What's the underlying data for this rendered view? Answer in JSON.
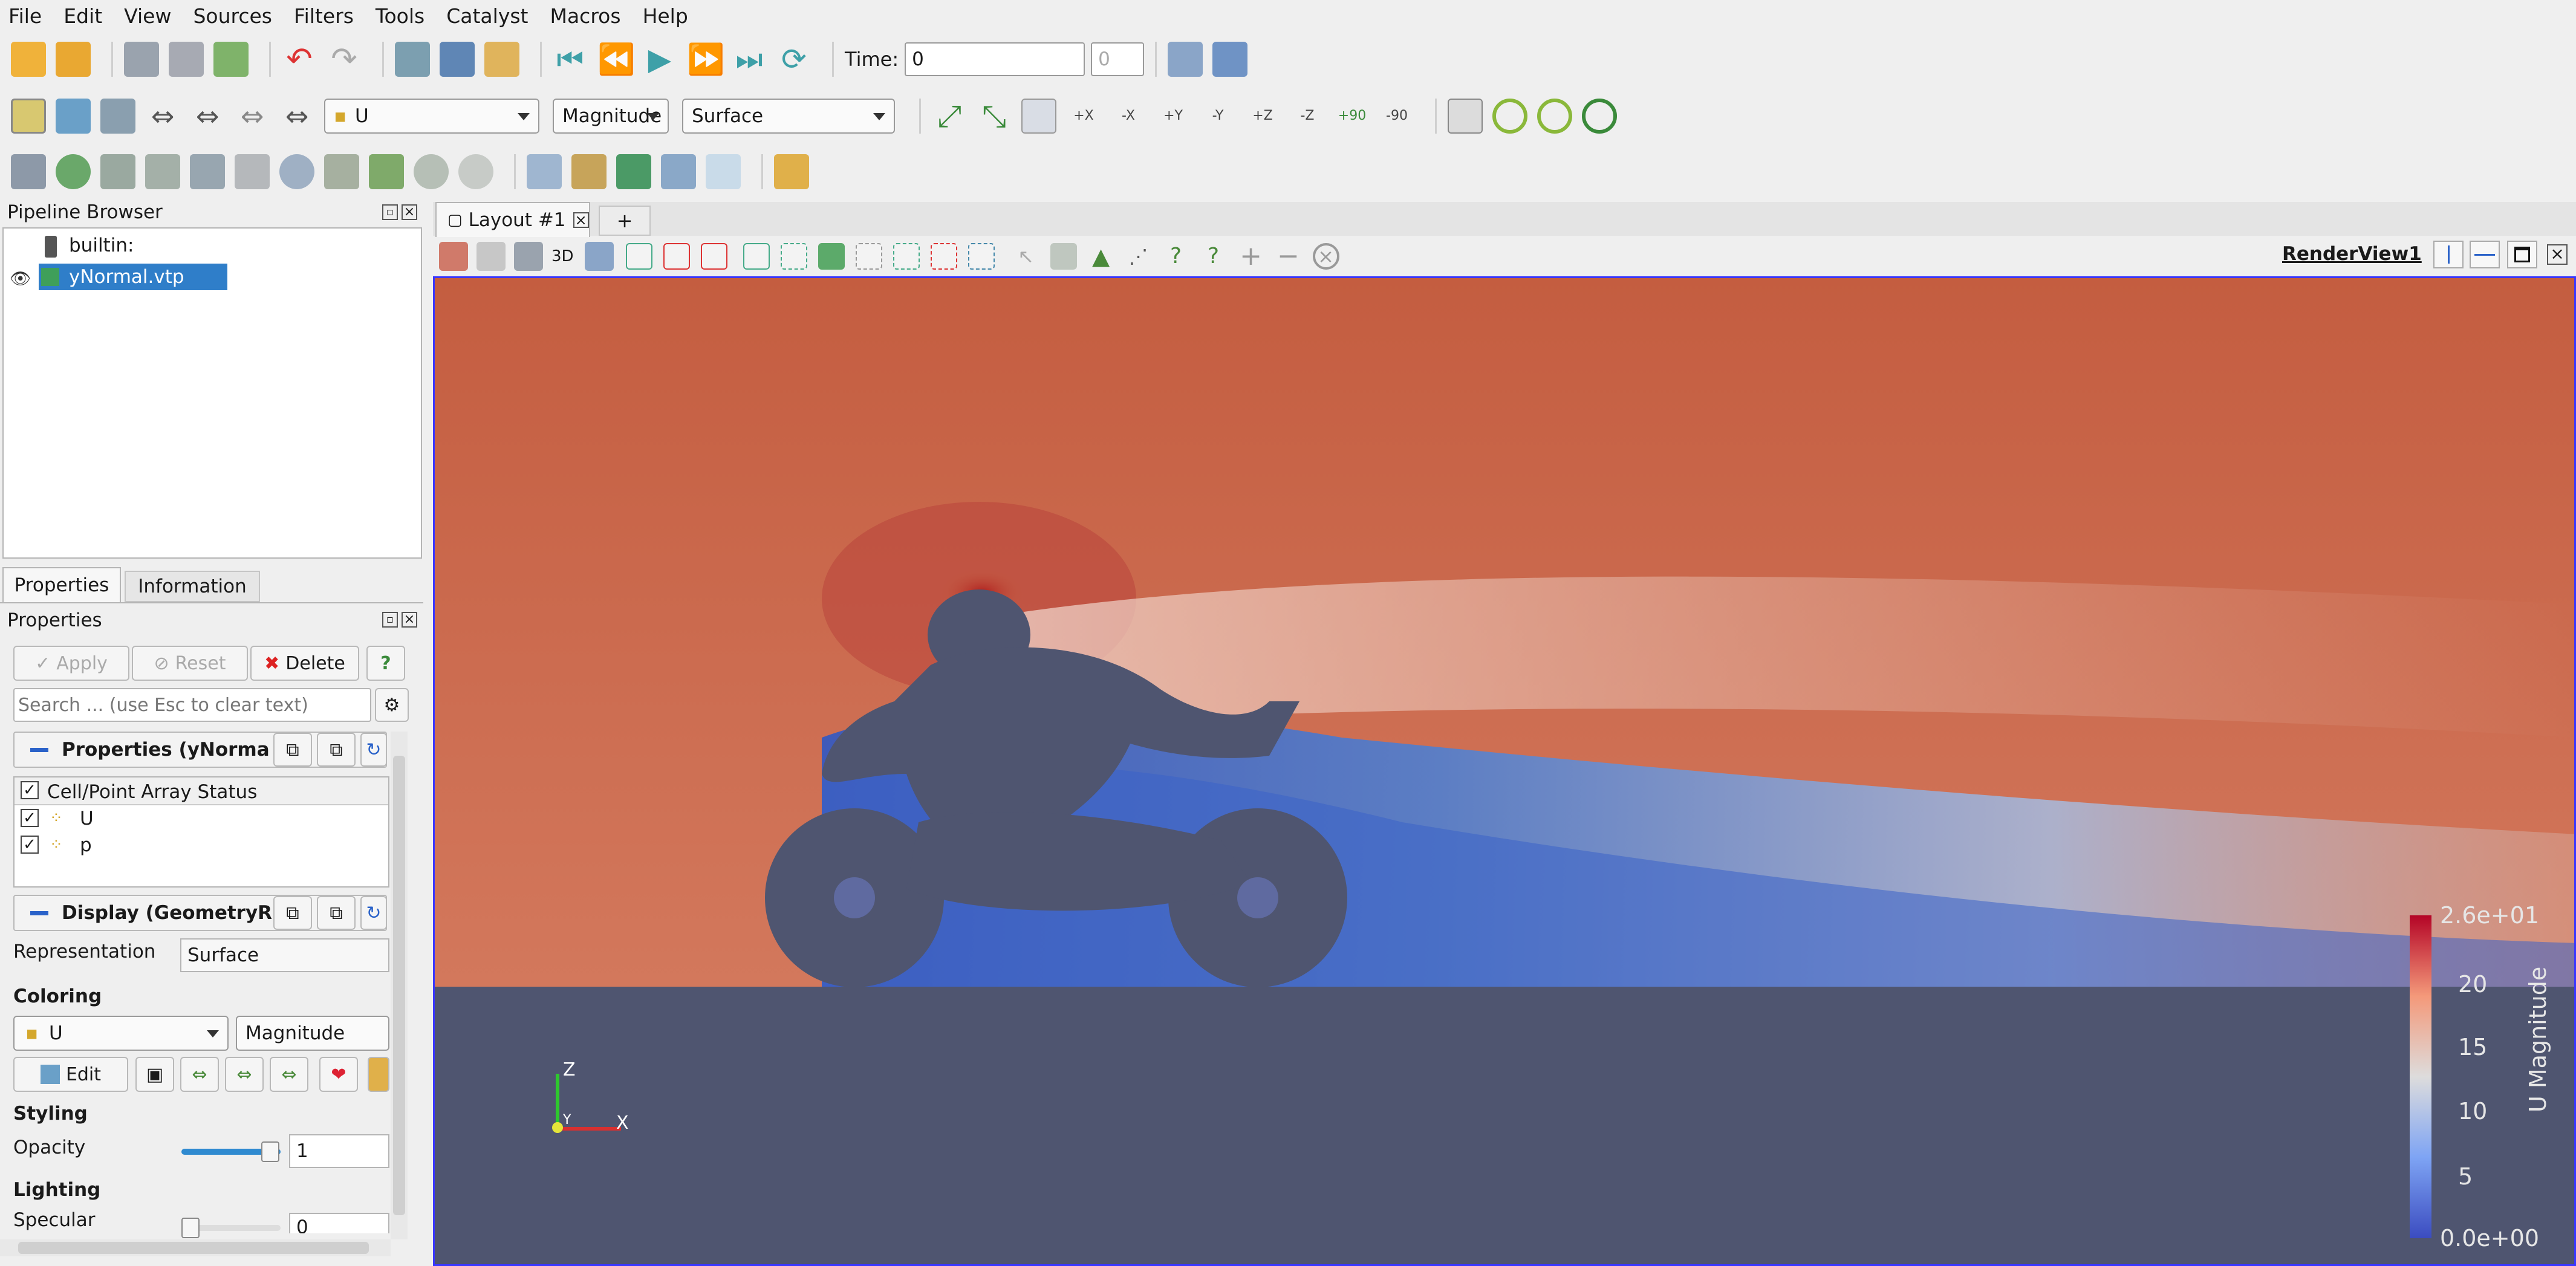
{
  "menu": [
    "File",
    "Edit",
    "View",
    "Sources",
    "Filters",
    "Tools",
    "Catalyst",
    "Macros",
    "Help"
  ],
  "toolbar": {
    "time_label": "Time:",
    "time_value": "0",
    "timestep_value": "0",
    "array_combo": "U",
    "component_combo": "Magnitude",
    "representation_combo": "Surface",
    "axis_labels": [
      "+X",
      "-X",
      "+Y",
      "-Y",
      "+Z",
      "-Z"
    ],
    "rotate_labels": [
      "+90",
      "-90"
    ]
  },
  "pipeline": {
    "title": "Pipeline Browser",
    "root": "builtin:",
    "item": "yNormal.vtp"
  },
  "tabs": {
    "properties": "Properties",
    "information": "Information"
  },
  "properties": {
    "title": "Properties",
    "apply": "Apply",
    "reset": "Reset",
    "delete": "Delete",
    "help": "?",
    "search_placeholder": "Search ... (use Esc to clear text)",
    "section_properties": "Properties (yNorma",
    "array_status_header": "Cell/Point Array Status",
    "arrays": [
      "U",
      "p"
    ],
    "section_display": "Display (GeometryR",
    "representation_label": "Representation",
    "representation_value": "Surface",
    "coloring_label": "Coloring",
    "coloring_array": "U",
    "coloring_component": "Magnitude",
    "edit_button": "Edit",
    "styling_label": "Styling",
    "opacity_label": "Opacity",
    "opacity_value": "1",
    "opacity_level": 1.0,
    "lighting_label": "Lighting",
    "specular_label": "Specular",
    "specular_value": "0",
    "specular_level": 0.0
  },
  "layout": {
    "tab_label": "Layout #1",
    "add_tab": "+",
    "view_name": "RenderView1",
    "view_toolbar_3d": "3D"
  },
  "scalar_bar": {
    "title": "U Magnitude",
    "ticks": [
      "2.6e+01",
      "20",
      "15",
      "10",
      "5",
      "0.0e+00"
    ]
  },
  "orientation_axes": {
    "x": "X",
    "y": "Y",
    "z": "Z"
  },
  "colors": {
    "flow_high": "#c45a3e",
    "flow_mid": "#d9a99a",
    "flow_low": "#3d63c7",
    "ground": "#4f5570",
    "body": "#4f5570",
    "selection": "#2f7ec9",
    "view_border": "#3a37ff"
  }
}
